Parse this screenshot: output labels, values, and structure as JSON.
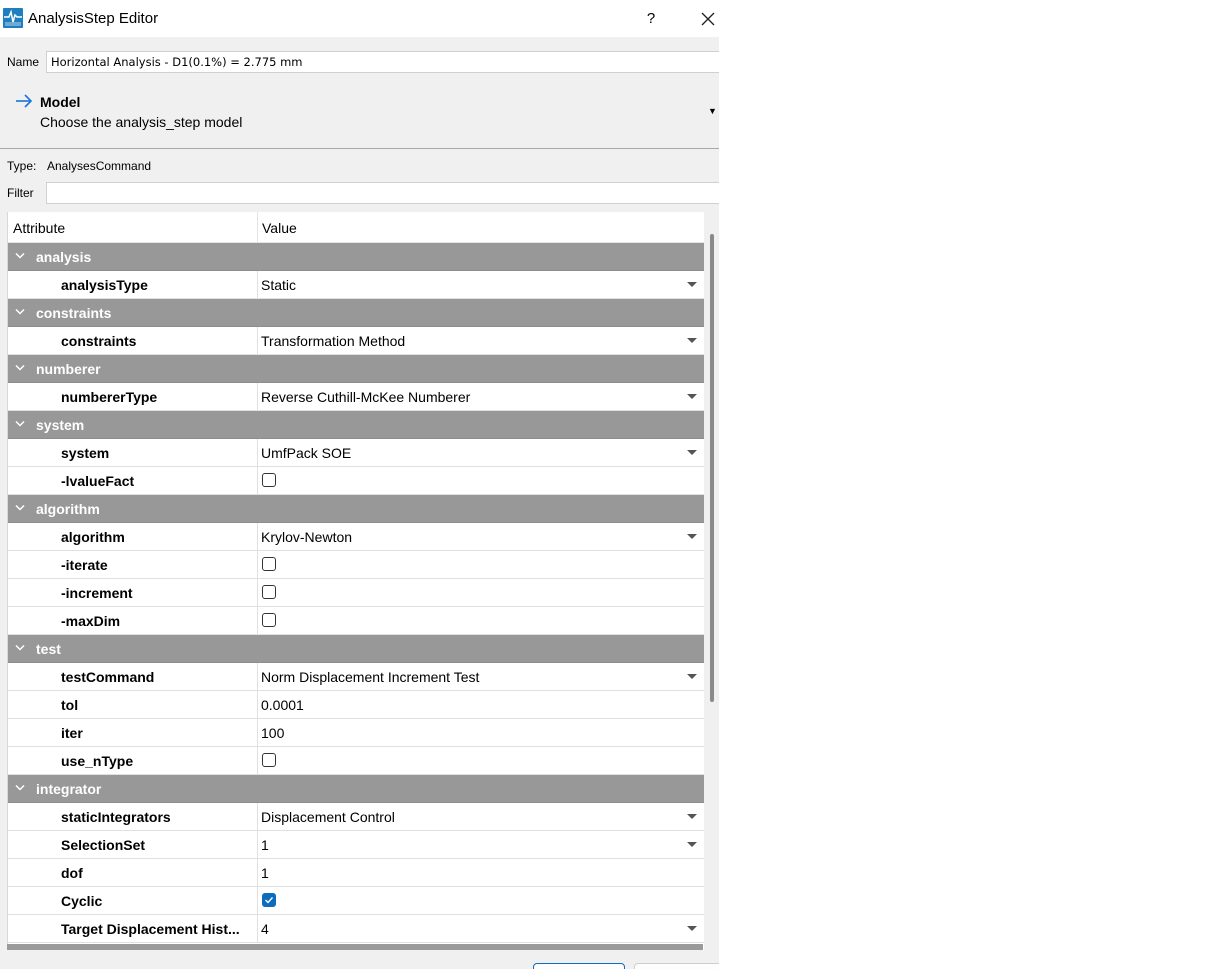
{
  "window": {
    "title": "AnalysisStep Editor",
    "help_label": "?"
  },
  "name_row": {
    "label": "Name",
    "value": "Horizontal Analysis - D1(0.1%) = 2.775 mm"
  },
  "model": {
    "title": "Model",
    "subtitle": "Choose the analysis_step model"
  },
  "type_row": {
    "label": "Type:",
    "value": "AnalysesCommand"
  },
  "filter_row": {
    "label": "Filter",
    "value": ""
  },
  "table": {
    "headers": {
      "attribute": "Attribute",
      "value": "Value"
    },
    "rows": [
      {
        "kind": "group",
        "label": "analysis"
      },
      {
        "kind": "combo",
        "label": "analysisType",
        "value": "Static"
      },
      {
        "kind": "group",
        "label": "constraints"
      },
      {
        "kind": "combo",
        "label": "constraints",
        "value": "Transformation Method"
      },
      {
        "kind": "group",
        "label": "numberer"
      },
      {
        "kind": "combo",
        "label": "numbererType",
        "value": "Reverse Cuthill-McKee Numberer"
      },
      {
        "kind": "group",
        "label": "system"
      },
      {
        "kind": "combo",
        "label": "system",
        "value": "UmfPack SOE"
      },
      {
        "kind": "check",
        "label": "-lvalueFact",
        "checked": false
      },
      {
        "kind": "group",
        "label": "algorithm"
      },
      {
        "kind": "combo",
        "label": "algorithm",
        "value": "Krylov-Newton"
      },
      {
        "kind": "check",
        "label": "-iterate",
        "checked": false
      },
      {
        "kind": "check",
        "label": "-increment",
        "checked": false
      },
      {
        "kind": "check",
        "label": "-maxDim",
        "checked": false
      },
      {
        "kind": "group",
        "label": "test"
      },
      {
        "kind": "combo",
        "label": "testCommand",
        "value": "Norm Displacement Increment Test"
      },
      {
        "kind": "text",
        "label": "tol",
        "value": "0.0001"
      },
      {
        "kind": "text",
        "label": "iter",
        "value": "100"
      },
      {
        "kind": "check",
        "label": "use_nType",
        "checked": false
      },
      {
        "kind": "group",
        "label": "integrator"
      },
      {
        "kind": "combo",
        "label": "staticIntegrators",
        "value": "Displacement Control"
      },
      {
        "kind": "combo",
        "label": "SelectionSet",
        "value": "1"
      },
      {
        "kind": "text",
        "label": "dof",
        "value": "1"
      },
      {
        "kind": "check",
        "label": "Cyclic",
        "checked": true
      },
      {
        "kind": "combo",
        "label": "Target Displacement Hist...",
        "value": "4"
      }
    ]
  },
  "colors": {
    "accent": "#0f6cbd",
    "group_row": "#989898",
    "dialog_bg": "#f0f0f0"
  },
  "icons": {
    "app": "app-logo-icon",
    "model": "arrow-right-icon",
    "expand": "chevron-down-icon"
  }
}
